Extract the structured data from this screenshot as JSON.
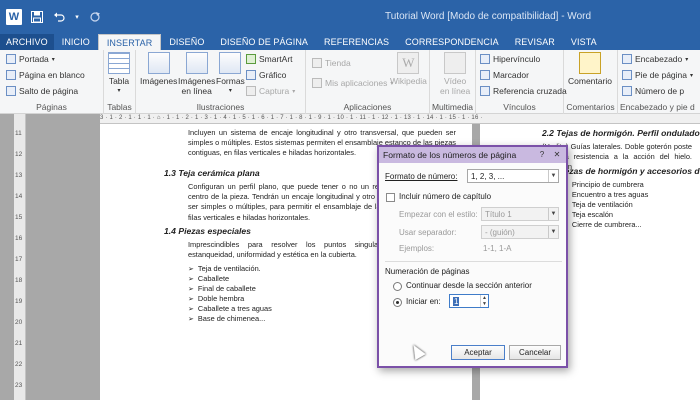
{
  "window": {
    "title": "Tutorial Word [Modo de compatibilidad] - Word"
  },
  "quick_access": {
    "icons": [
      "word-logo",
      "save-icon",
      "undo-icon",
      "undo-dropdown-icon",
      "redo-icon"
    ]
  },
  "tabs": [
    {
      "label": "ARCHIVO"
    },
    {
      "label": "INICIO"
    },
    {
      "label": "INSERTAR"
    },
    {
      "label": "DISEÑO"
    },
    {
      "label": "DISEÑO DE PÁGINA"
    },
    {
      "label": "REFERENCIAS"
    },
    {
      "label": "CORRESPONDENCIA"
    },
    {
      "label": "REVISAR"
    },
    {
      "label": "VISTA"
    }
  ],
  "ribbon": {
    "paginas": {
      "label": "Páginas",
      "portada": "Portada",
      "pagina_en_blanco": "Página en blanco",
      "salto_de_pagina": "Salto de página"
    },
    "tablas": {
      "label": "Tablas",
      "tabla": "Tabla"
    },
    "ilustraciones": {
      "label": "Ilustraciones",
      "imagenes": "Imágenes",
      "imagenes_en_linea_1": "Imágenes",
      "imagenes_en_linea_2": "en línea",
      "formas": "Formas",
      "smartart": "SmartArt",
      "grafico": "Gráfico",
      "captura": "Captura"
    },
    "aplicaciones": {
      "label": "Aplicaciones",
      "tienda": "Tienda",
      "mis_aplicaciones": "Mis aplicaciones",
      "wikipedia": "Wikipedia"
    },
    "multimedia": {
      "label": "Multimedia",
      "video_1": "Vídeo",
      "video_2": "en línea"
    },
    "vinculos": {
      "label": "Vínculos",
      "hipervinculo": "Hipervínculo",
      "marcador": "Marcador",
      "referencia_cruzada": "Referencia cruzada"
    },
    "comentarios": {
      "label": "Comentarios",
      "comentario": "Comentario"
    },
    "encabezado_pie": {
      "label": "Encabezado y pie d",
      "encabezado": "Encabezado",
      "pie_de_pagina": "Pie de página",
      "numero_de_pagina": "Número de p"
    }
  },
  "ruler": {
    "horizontal_ticks": "3 · 1 · 2 · 1 · 1 · 1 · ⌂ · 1 · 1 · 2 · 1 · 3 · 1 · 4 · 1 · 5 · 1 · 6 · 1 · 7 · 1 · 8 · 1 · 9 · 1 · 10 · 1 · 11 · 1 · 12 · 1 · 13 · 1 · 14 · 1 · 15 · 1 · 16 ·",
    "vertical_ticks": [
      "11",
      "12",
      "13",
      "14",
      "15",
      "16",
      "17",
      "18",
      "19",
      "20",
      "21",
      "22",
      "23"
    ]
  },
  "document": {
    "page1": {
      "intro": "Incluyen un sistema de encaje longitudinal y otro transversal, que pueden ser simples o múltiples. Estos sistemas permiten el ensamblaje estanco de las piezas contiguas, en filas verticales e hiladas horizontales.",
      "h13": "1.3 Teja cerámica plana",
      "p13": "Configuran un perfil plano, que puede tener o no un resalte longitudinal en el centro de la pieza. Tendrán un encaje longitudinal y otro transversal, que podrán ser simples o múltiples, para permitir el ensamblaje de las piezas contiguas, en filas verticales e hiladas horizontales.",
      "h14": "1.4 Piezas especiales",
      "p14": "Imprescindibles para resolver los puntos singulares, garantizando la estanqueidad, uniformidad y estética en la cubierta.",
      "bullets": [
        "Teja de ventilación.",
        "Caballete",
        "Final de caballete",
        "Doble hembra",
        "Caballete a tres aguas",
        "Base de chimenea..."
      ]
    },
    "page2": {
      "h22": "2.2 Tejas de hormigón. Perfil ondulado",
      "p22": "(Uralita)  Guías laterales. Doble goterón poste Elevada resistencia a la acción del hielo. Totalmen",
      "h23": "2.3 Piezas de hormigón y accesorios de",
      "bullets": [
        "Principio de cumbrera",
        "Encuentro a tres aguas",
        "Teja de ventilación",
        "Teja escalón",
        "Cierre de cumbrera..."
      ]
    }
  },
  "dialog": {
    "title": "Formato de los números de página",
    "help": "?",
    "close": "✕",
    "formato_label": "Formato de número:",
    "formato_value": "1, 2, 3, ...",
    "incluir_capitulo": "Incluir número de capítulo",
    "empezar_label": "Empezar con el estilo:",
    "empezar_value": "Título 1",
    "separador_label": "Usar separador:",
    "separador_value": "-    (guión)",
    "ejemplos_label": "Ejemplos:",
    "ejemplos_value": "1-1, 1-A",
    "numeracion_label": "Numeración de páginas",
    "continuar": "Continuar desde la sección anterior",
    "iniciar_en": "Iniciar en:",
    "iniciar_value": "1",
    "aceptar": "Aceptar",
    "cancelar": "Cancelar"
  }
}
